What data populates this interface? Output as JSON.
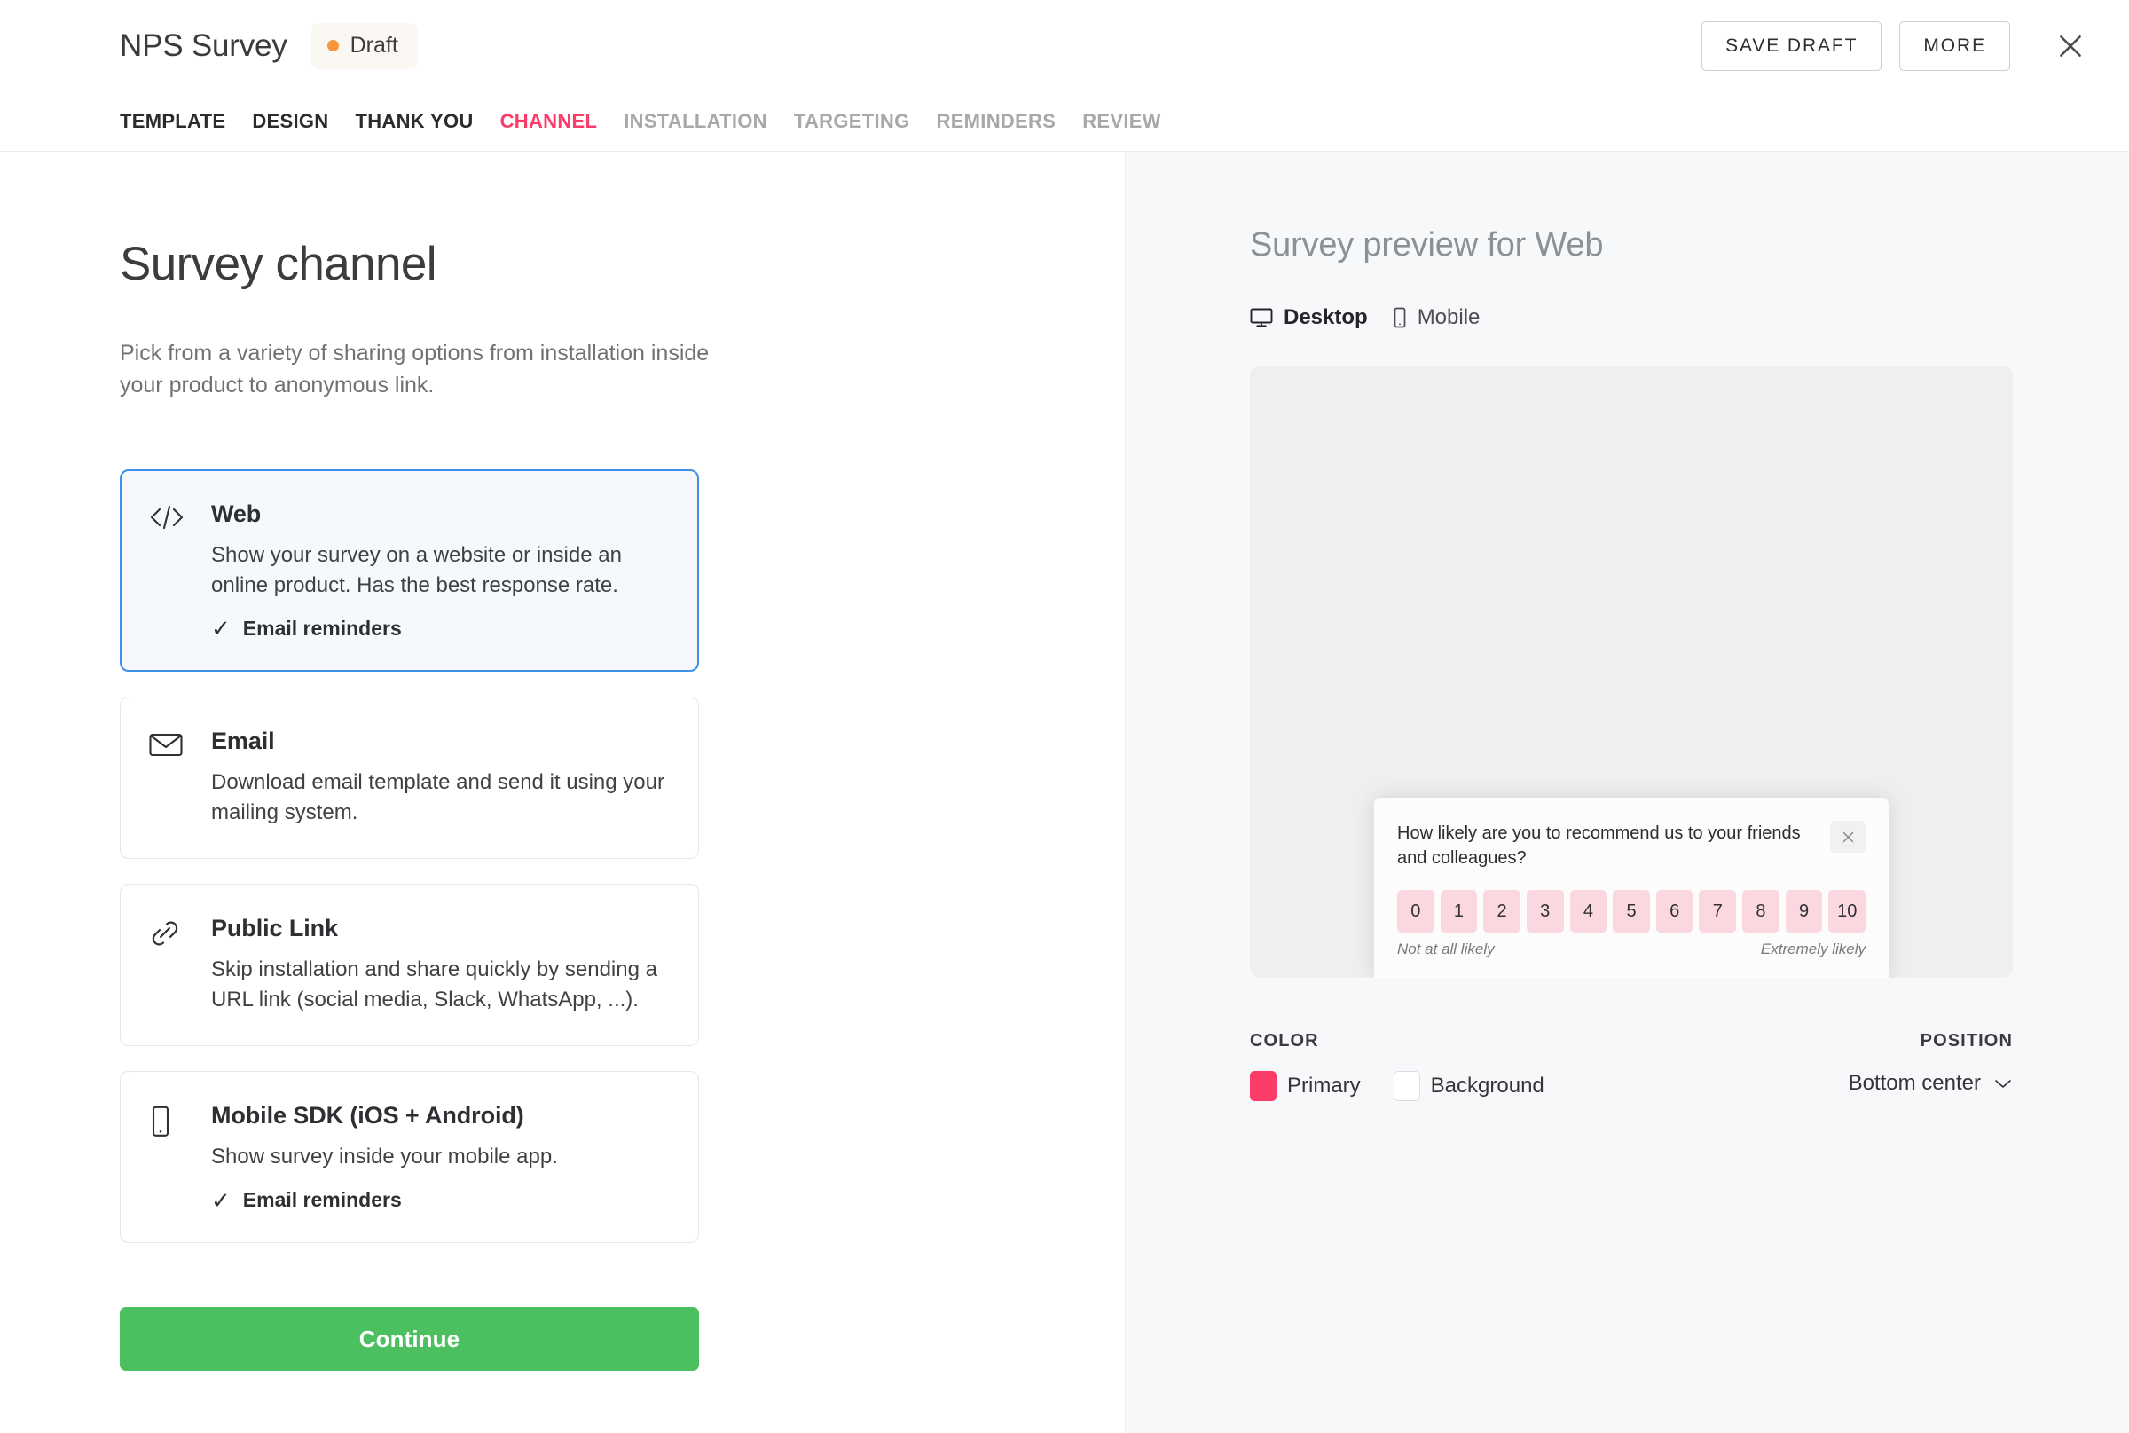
{
  "header": {
    "title": "NPS Survey",
    "status_badge": {
      "label": "Draft",
      "dot_color": "#F7963A",
      "bg_color": "#FBF7F2"
    },
    "save_draft_label": "SAVE DRAFT",
    "more_label": "MORE",
    "close_icon": "close-icon"
  },
  "tabs": [
    {
      "label": "TEMPLATE",
      "state": "done"
    },
    {
      "label": "DESIGN",
      "state": "done"
    },
    {
      "label": "THANK YOU",
      "state": "done"
    },
    {
      "label": "CHANNEL",
      "state": "active"
    },
    {
      "label": "INSTALLATION",
      "state": "upcoming"
    },
    {
      "label": "TARGETING",
      "state": "upcoming"
    },
    {
      "label": "REMINDERS",
      "state": "upcoming"
    },
    {
      "label": "REVIEW",
      "state": "upcoming"
    }
  ],
  "left": {
    "page_title": "Survey channel",
    "page_description": "Pick from a variety of sharing options from installation inside your product to anonymous link.",
    "options": [
      {
        "icon": "code-icon",
        "title": "Web",
        "description": "Show your survey on a website or inside an online product. Has the best response rate.",
        "feature": "Email reminders",
        "selected": true
      },
      {
        "icon": "envelope-icon",
        "title": "Email",
        "description": "Download email template and send it using your mailing system.",
        "feature": "",
        "selected": false
      },
      {
        "icon": "link-icon",
        "title": "Public Link",
        "description": "Skip installation and share quickly by sending a URL link (social media, Slack, WhatsApp, ...).",
        "feature": "",
        "selected": false
      },
      {
        "icon": "mobile-icon",
        "title": "Mobile SDK (iOS + Android)",
        "description": "Show survey inside your mobile app.",
        "feature": "Email reminders",
        "selected": false
      }
    ],
    "continue_label": "Continue"
  },
  "right": {
    "preview_title": "Survey preview for Web",
    "device_tabs": [
      {
        "label": "Desktop",
        "icon": "monitor-icon",
        "active": true
      },
      {
        "label": "Mobile",
        "icon": "phone-icon",
        "active": false
      }
    ],
    "survey_widget": {
      "question": "How likely are you to recommend us to your friends and colleagues?",
      "close_icon": "close-icon",
      "scale": [
        "0",
        "1",
        "2",
        "3",
        "4",
        "5",
        "6",
        "7",
        "8",
        "9",
        "10"
      ],
      "low_label": "Not at all likely",
      "high_label": "Extremely likely",
      "scale_button_color": "#FBD8E0"
    },
    "color_section": {
      "label": "COLOR",
      "primary_label": "Primary",
      "primary_color": "#FB3B68",
      "background_label": "Background",
      "background_color": "#FFFFFF"
    },
    "position_section": {
      "label": "POSITION",
      "value": "Bottom center",
      "chevron_icon": "chevron-down-icon"
    }
  }
}
